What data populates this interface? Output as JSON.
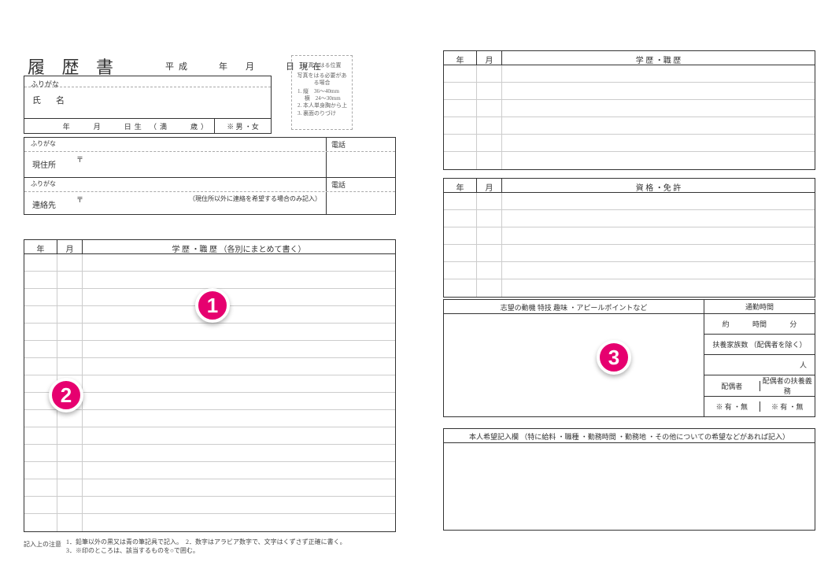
{
  "title": "履 歴 書",
  "date_line": "平成　　年　月　　日現在",
  "photo": {
    "title": "写真をはる位置",
    "note": "写真をはる必要がある場合",
    "l1": "1. 縦　36～40mm",
    "l1b": "　 横　24～30mm",
    "l2": "2. 本人単身胸から上",
    "l3": "3. 裏面のりづけ"
  },
  "personal": {
    "furigana": "ふりがな",
    "name_label": "氏　名",
    "dob": "年　　月　　日生 （満　　歳）",
    "gender": "※ 男 ・女"
  },
  "address": {
    "furigana": "ふりがな",
    "current_label": "現住所",
    "post": "〒",
    "tel": "電話",
    "contact_label": "連絡先",
    "contact_note": "（現住所以外に連絡を希望する場合のみ記入）"
  },
  "history": {
    "year": "年",
    "month": "月",
    "header_left": "学 歴 ・職 歴 （各別にまとめて書く）",
    "header_right1": "学 歴 ・職 歴",
    "header_right2": "資 格 ・免 許"
  },
  "motivation": {
    "header": "志望の動機 特技 趣味 ・アピールポイントなど",
    "commute_label": "通勤時間",
    "commute_val_about": "約",
    "commute_val_hour": "時間",
    "commute_val_min": "分",
    "dependents_label": "扶養家族数 （配偶者を除く）",
    "dependents_unit": "人",
    "spouse_label": "配偶者",
    "spouse_support_label": "配偶者の扶養義務",
    "yesno": "※ 有 ・無"
  },
  "wish": {
    "header": "本人希望記入欄 （特に給料 ・職種 ・勤務時間 ・勤務地 ・その他についての希望などがあれば記入）"
  },
  "notes": {
    "label": "記入上の注意",
    "line1": "1．鉛筆以外の黒又は青の筆記具で記入。　2．数字はアラビア数字で、文字はくずさず正確に書く。",
    "line2": "3．※印のところは、該当するものを○で囲む。"
  },
  "badges": {
    "b1": "1",
    "b2": "2",
    "b3": "3"
  }
}
